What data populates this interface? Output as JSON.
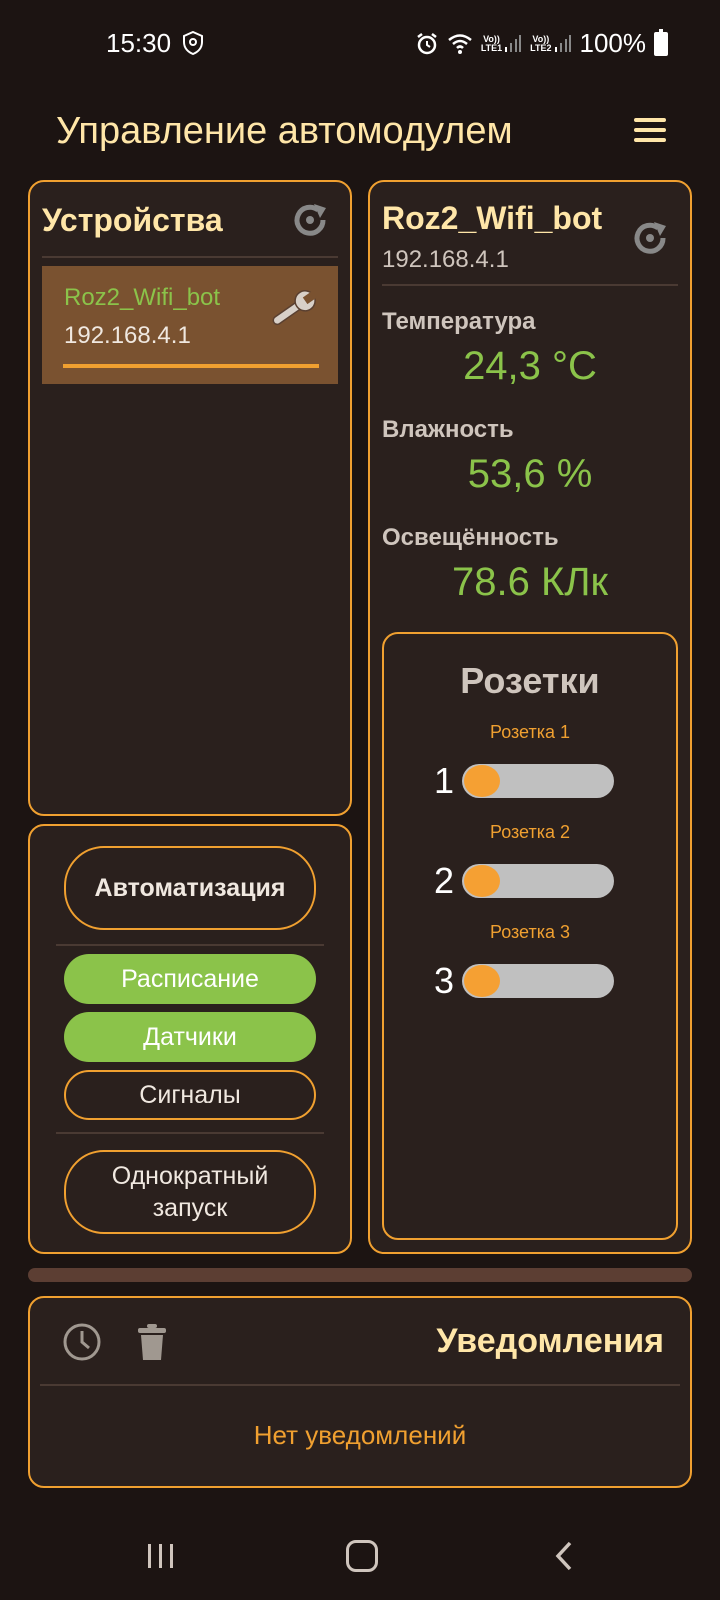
{
  "status_bar": {
    "time": "15:30",
    "battery": "100%",
    "sim1": "LTE1",
    "sim2": "LTE2",
    "volte": "Vo))",
    "icons": [
      "shield-icon",
      "alarm-icon",
      "wifi-icon",
      "signal-icon",
      "battery-icon"
    ]
  },
  "header": {
    "title": "Управление автомодулем",
    "menu_icon": "menu-icon"
  },
  "devices": {
    "title": "Устройства",
    "items": [
      {
        "name": "Roz2_Wifi_bot",
        "ip": "192.168.4.1"
      }
    ]
  },
  "automation": {
    "main_label": "Автоматизация",
    "schedule_label": "Расписание",
    "sensors_label": "Датчики",
    "signals_label": "Сигналы",
    "once_label": "Однократный запуск"
  },
  "device_detail": {
    "name": "Roz2_Wifi_bot",
    "ip": "192.168.4.1",
    "sensors": [
      {
        "label": "Температура",
        "value": "24,3 °C"
      },
      {
        "label": "Влажность",
        "value": "53,6 %"
      },
      {
        "label": "Освещённость",
        "value": "78.6 КЛк"
      }
    ]
  },
  "sockets": {
    "title": "Розетки",
    "items": [
      {
        "label": "Розетка 1",
        "number": "1",
        "on": false
      },
      {
        "label": "Розетка 2",
        "number": "2",
        "on": false
      },
      {
        "label": "Розетка 3",
        "number": "3",
        "on": false
      }
    ]
  },
  "notifications": {
    "title": "Уведомления",
    "empty_text": "Нет уведомлений"
  },
  "colors": {
    "accent": "#f0a030",
    "green": "#8bc34a",
    "title": "#ffe6a8",
    "background": "#1c1412"
  }
}
